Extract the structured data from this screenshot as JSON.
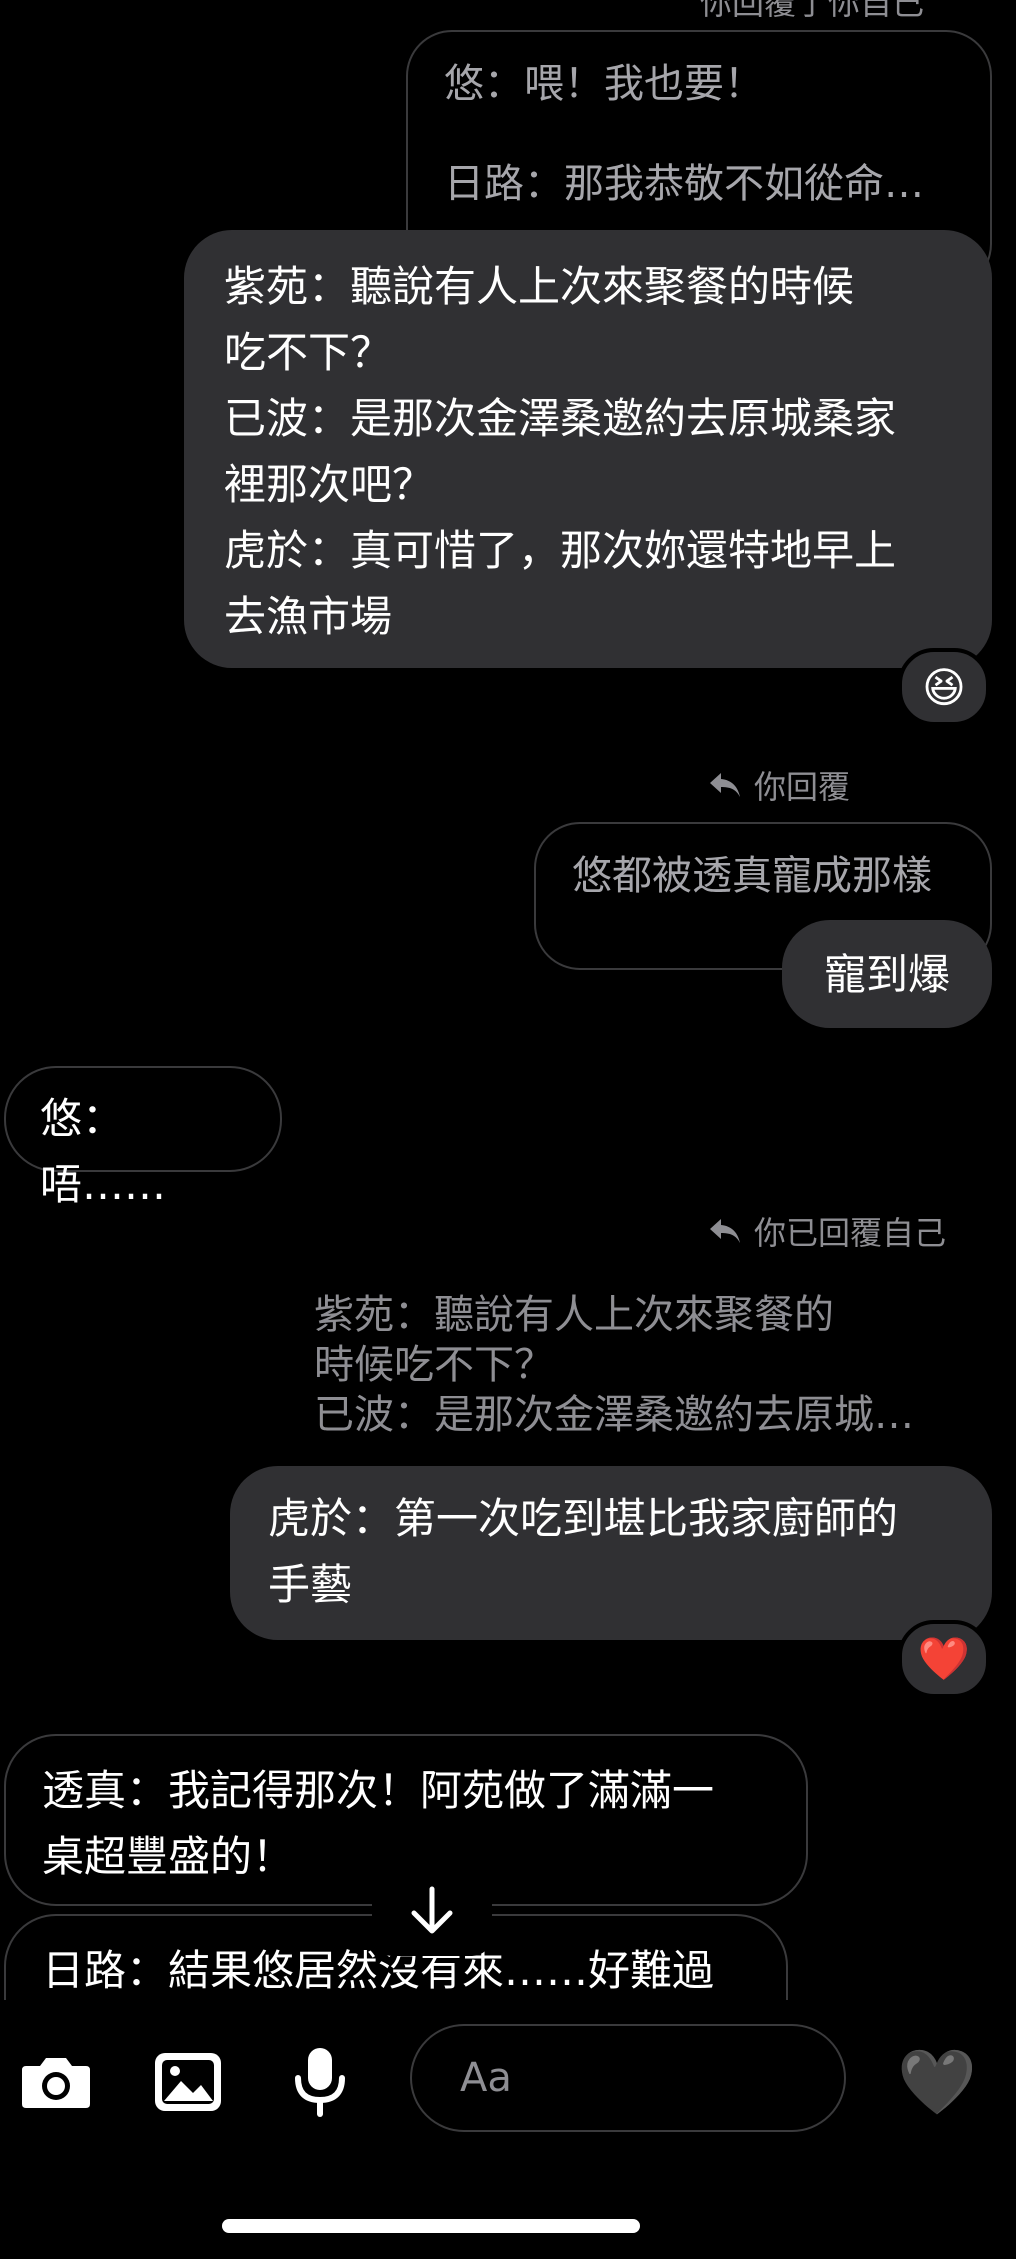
{
  "top_cut_header": "你回覆了你自己",
  "thread1": {
    "quote_lines": [
      "悠：喂！我也要！",
      "日路：那我恭敬不如從命…"
    ],
    "bubble_lines": [
      "紫苑：聽說有人上次來聚餐的時候",
      "吃不下？",
      "已波：是那次金澤桑邀約去原城桑家",
      "裡那次吧？",
      "虎於：真可惜了，那次妳還特地早上",
      "去漁市場"
    ],
    "reaction": "😆"
  },
  "thread2": {
    "reply_header": "你回覆",
    "quote": "悠都被透真寵成那樣",
    "bubble": "寵到爆"
  },
  "incoming1": "悠：唔……",
  "thread3": {
    "reply_header": "你已回覆自己",
    "quote_lines": [
      "紫苑：聽說有人上次來聚餐的",
      "時候吃不下？",
      "已波：是那次金澤桑邀約去原城…"
    ],
    "bubble_lines": [
      "虎於：第一次吃到堪比我家廚師的",
      "手藝"
    ],
    "reaction": "❤️"
  },
  "incoming2_lines": [
    "透真：我記得那次！阿苑做了滿滿一",
    "桌超豐盛的！"
  ],
  "incoming3": "日路：結果悠居然沒有來……好難過",
  "composer": {
    "placeholder": "Aa",
    "like_emoji": "🖤"
  },
  "icons": [
    "camera-icon",
    "gallery-icon",
    "microphone-icon",
    "emoji-icon",
    "reply-arrow-icon",
    "arrow-down-icon"
  ]
}
